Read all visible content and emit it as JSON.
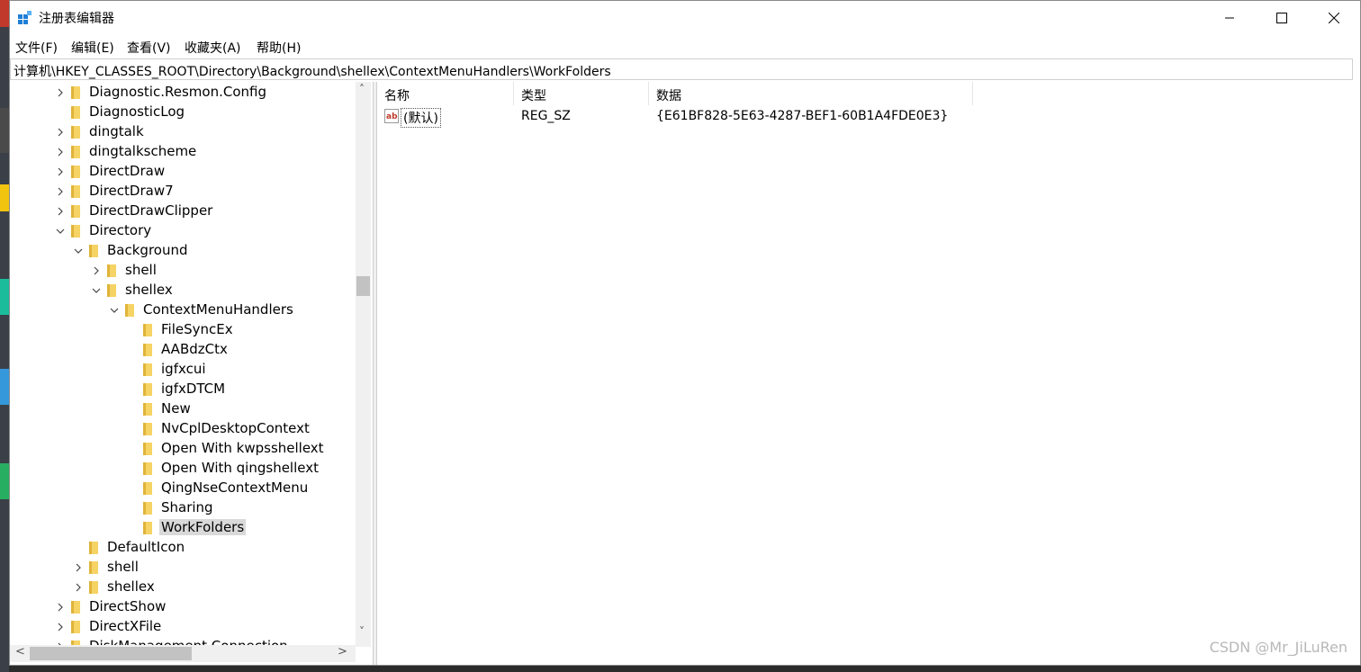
{
  "window": {
    "title": "注册表编辑器",
    "controls": {
      "minimize": "—",
      "maximize": "☐",
      "close": "✕"
    }
  },
  "menu": [
    "文件(F)",
    "编辑(E)",
    "查看(V)",
    "收藏夹(A)",
    "帮助(H)"
  ],
  "address": "计算机\\HKEY_CLASSES_ROOT\\Directory\\Background\\shellex\\ContextMenuHandlers\\WorkFolders",
  "tree": [
    {
      "label": "Diagnostic.Resmon.Config",
      "level": 0,
      "expander": "collapsed"
    },
    {
      "label": "DiagnosticLog",
      "level": 0,
      "expander": "none"
    },
    {
      "label": "dingtalk",
      "level": 0,
      "expander": "collapsed"
    },
    {
      "label": "dingtalkscheme",
      "level": 0,
      "expander": "collapsed"
    },
    {
      "label": "DirectDraw",
      "level": 0,
      "expander": "collapsed"
    },
    {
      "label": "DirectDraw7",
      "level": 0,
      "expander": "collapsed"
    },
    {
      "label": "DirectDrawClipper",
      "level": 0,
      "expander": "collapsed"
    },
    {
      "label": "Directory",
      "level": 0,
      "expander": "expanded"
    },
    {
      "label": "Background",
      "level": 1,
      "expander": "expanded"
    },
    {
      "label": "shell",
      "level": 2,
      "expander": "collapsed"
    },
    {
      "label": "shellex",
      "level": 2,
      "expander": "expanded"
    },
    {
      "label": "ContextMenuHandlers",
      "level": 3,
      "expander": "expanded"
    },
    {
      "label": " FileSyncEx",
      "level": 4,
      "expander": "none"
    },
    {
      "label": "AABdzCtx",
      "level": 4,
      "expander": "none"
    },
    {
      "label": "igfxcui",
      "level": 4,
      "expander": "none"
    },
    {
      "label": "igfxDTCM",
      "level": 4,
      "expander": "none"
    },
    {
      "label": "New",
      "level": 4,
      "expander": "none"
    },
    {
      "label": "NvCplDesktopContext",
      "level": 4,
      "expander": "none"
    },
    {
      "label": "Open With kwpsshellext",
      "level": 4,
      "expander": "none"
    },
    {
      "label": "Open With qingshellext",
      "level": 4,
      "expander": "none"
    },
    {
      "label": "QingNseContextMenu",
      "level": 4,
      "expander": "none"
    },
    {
      "label": "Sharing",
      "level": 4,
      "expander": "none"
    },
    {
      "label": "WorkFolders",
      "level": 4,
      "expander": "none",
      "selected": true
    },
    {
      "label": "DefaultIcon",
      "level": 1,
      "expander": "none"
    },
    {
      "label": "shell",
      "level": 1,
      "expander": "collapsed"
    },
    {
      "label": "shellex",
      "level": 1,
      "expander": "collapsed"
    },
    {
      "label": "DirectShow",
      "level": 0,
      "expander": "collapsed"
    },
    {
      "label": "DirectXFile",
      "level": 0,
      "expander": "collapsed"
    },
    {
      "label": "DiskManagement.Connection",
      "level": 0,
      "expander": "collapsed"
    }
  ],
  "list": {
    "columns": [
      "名称",
      "类型",
      "数据"
    ],
    "rows": [
      {
        "name": "(默认)",
        "type": "REG_SZ",
        "data": "{E61BF828-5E63-4287-BEF1-60B1A4FDE0E3}",
        "icon": "string-value-icon"
      }
    ]
  },
  "scrollbar": {
    "up": "˄",
    "down": "˅",
    "left": "<",
    "right": ">"
  },
  "watermark": "CSDN @Mr_JiLuRen",
  "colors": {
    "folder": "#f6d365",
    "selection": "#d9d9d9",
    "title_icon": "#1e7fd6"
  }
}
